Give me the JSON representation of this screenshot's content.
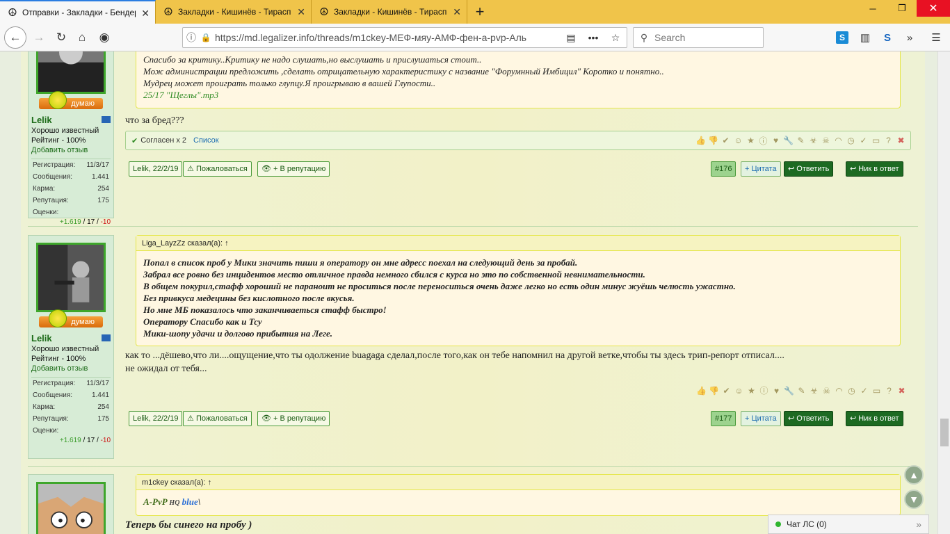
{
  "browser": {
    "tabs": [
      {
        "title": "Отправки - Закладки - Бендер",
        "active": true
      },
      {
        "title": "Закладки - Кишинёв - Тирасп",
        "active": false
      },
      {
        "title": "Закладки - Кишинёв - Тирасп",
        "active": false
      }
    ],
    "url": "https://md.legalizer.info/threads/m1ckey-МЕФ-мяу-АМФ-фен-а-pvp-Аль",
    "search_placeholder": "Search",
    "accent": "#f0c44a"
  },
  "posts": [
    {
      "user": {
        "name": "Lelik",
        "title": "Хорошо известный",
        "rating": "Рейтинг - 100%",
        "feedback": "Добавить отзыв",
        "rank_label": "думаю",
        "stats": [
          {
            "label": "Регистрация:",
            "value": "11/3/17"
          },
          {
            "label": "Сообщения:",
            "value": "1.441"
          },
          {
            "label": "Карма:",
            "value": "254"
          },
          {
            "label": "Репутация:",
            "value": "175"
          },
          {
            "label": "Оценки:",
            "value": ""
          }
        ],
        "scores": {
          "pos": "+1.619",
          "mid": "17",
          "neg": "-10"
        }
      },
      "quote_lines": [
        "Спасибо за критику..Критику не надо слушать,но выслушать и прислушаться стоит..",
        "Мож администрации предложить ,сделать отрицательную характеристику с название \"Форумнный Имбицил\" Коротко и понятно..",
        "Мудрец может проиграть только глупцу.Я проигрываю в вашей Глупости..",
        "25/17 \"Щеглы\".mp3"
      ],
      "text": "что за бред???",
      "likes": {
        "agree": "Согласен x 2",
        "list": "Список"
      },
      "date": "Lelik, 22/2/19",
      "report": "Пожаловаться",
      "rep": "+ В репутацию",
      "num": "#176",
      "quote_btn": "+ Цитата",
      "reply": "Ответить",
      "nick": "Ник в ответ"
    },
    {
      "user": {
        "name": "Lelik",
        "title": "Хорошо известный",
        "rating": "Рейтинг - 100%",
        "feedback": "Добавить отзыв",
        "rank_label": "думаю",
        "stats": [
          {
            "label": "Регистрация:",
            "value": "11/3/17"
          },
          {
            "label": "Сообщения:",
            "value": "1.441"
          },
          {
            "label": "Карма:",
            "value": "254"
          },
          {
            "label": "Репутация:",
            "value": "175"
          },
          {
            "label": "Оценки:",
            "value": ""
          }
        ],
        "scores": {
          "pos": "+1.619",
          "mid": "17",
          "neg": "-10"
        }
      },
      "quote_author": "Liga_LayzZz сказал(а): ↑",
      "quote_lines": [
        "Попал в список проб у Мики значить пиши я оператору он мне адресс поехал на следующий день за пробай.",
        "Забрал все ровно без инцидентов место отличное правда немного сбился с курса но это по собственной невнимательности.",
        "В общем покурил,стафф хороший не параноит не проситься после переноситься очень даже легко но есть один минус жуёшь челюсть ужастно.",
        "Без привкуса медецины без кислотного после вкусья.",
        "Но мне МБ показалось что заканчиваеться стафф быстро!",
        "Оператору Спасибо как и Тсу",
        "Мики-шопу удачи и долгово прибытия на Леге."
      ],
      "text_lines": [
        "как то ...дёшево,что ли....ощущение,что ты одолжение buagaga сделал,после того,как он тебе напомнил на другой ветке,чтобы ты здесь трип-репорт отписал....",
        "не ожидал от тебя..."
      ],
      "date": "Lelik, 22/2/19",
      "report": "Пожаловаться",
      "rep": "+ В репутацию",
      "num": "#177",
      "quote_btn": "+ Цитата",
      "reply": "Ответить",
      "nick": "Ник в ответ"
    },
    {
      "quote_author": "m1ckey сказал(а): ↑",
      "quote_a": "A-PvP",
      "quote_b": "HQ",
      "quote_c": "blue",
      "text": "Теперь бы синего на пробу )"
    }
  ],
  "reaction_icons": [
    "thumbs-up-icon",
    "thumbs-down-icon",
    "check-icon",
    "smile-icon",
    "star-icon",
    "info-icon",
    "heart-icon",
    "wrench-icon",
    "pencil-icon",
    "biohazard-icon",
    "skull-icon",
    "rainbow-icon",
    "clock-icon",
    "abc-icon",
    "box-icon",
    "question-icon",
    "close-icon"
  ],
  "chat": {
    "label": "Чат ЛС (0)"
  }
}
